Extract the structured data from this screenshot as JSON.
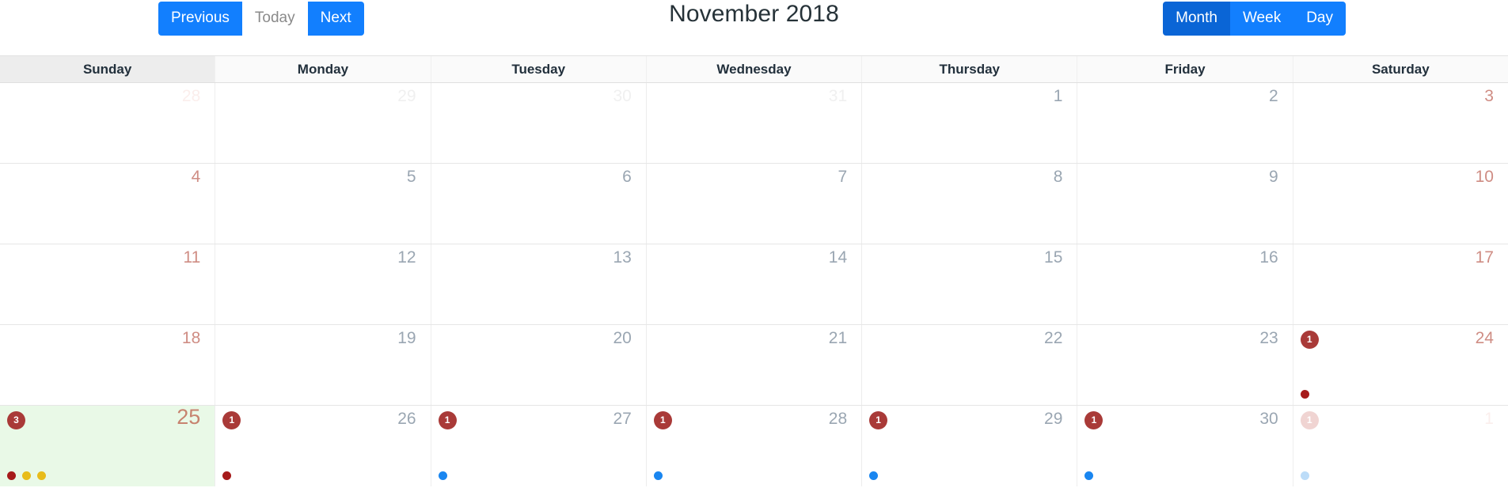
{
  "toolbar": {
    "nav_buttons": [
      {
        "label": "Previous",
        "name": "previous-button",
        "style": "primary"
      },
      {
        "label": "Today",
        "name": "today-button",
        "style": "light"
      },
      {
        "label": "Next",
        "name": "next-button",
        "style": "primary"
      }
    ],
    "title": "November 2018",
    "view_buttons": [
      {
        "label": "Month",
        "name": "month-view-button",
        "style": "active"
      },
      {
        "label": "Week",
        "name": "week-view-button",
        "style": "primary"
      },
      {
        "label": "Day",
        "name": "day-view-button",
        "style": "primary"
      }
    ]
  },
  "colors": {
    "primary_blue": "#127ffe",
    "active_blue": "#0a65d6",
    "badge_red": "#a93a38",
    "badge_red_faded": "#f0d4d2",
    "today_bg": "#e9f9e7",
    "dot_red": "#a61b1b",
    "dot_yellow": "#e8bc1a",
    "dot_blue": "#1a86f0",
    "dot_blue_faded": "#bcdcf8",
    "title_text": "#263238",
    "weekend_date": "#cf8d84",
    "weekday_date": "#9aa6b2"
  },
  "calendar": {
    "day_headers": [
      {
        "label": "Sunday",
        "weekend": true
      },
      {
        "label": "Monday",
        "weekend": false
      },
      {
        "label": "Tuesday",
        "weekend": false
      },
      {
        "label": "Wednesday",
        "weekend": false
      },
      {
        "label": "Thursday",
        "weekend": false
      },
      {
        "label": "Friday",
        "weekend": false
      },
      {
        "label": "Saturday",
        "weekend": false
      }
    ],
    "weeks": [
      [
        {
          "day": "28",
          "other_month": true,
          "weekend": true,
          "today": false,
          "badge": null,
          "dots": []
        },
        {
          "day": "29",
          "other_month": true,
          "weekend": false,
          "today": false,
          "badge": null,
          "dots": []
        },
        {
          "day": "30",
          "other_month": true,
          "weekend": false,
          "today": false,
          "badge": null,
          "dots": []
        },
        {
          "day": "31",
          "other_month": true,
          "weekend": false,
          "today": false,
          "badge": null,
          "dots": []
        },
        {
          "day": "1",
          "other_month": false,
          "weekend": false,
          "today": false,
          "badge": null,
          "dots": []
        },
        {
          "day": "2",
          "other_month": false,
          "weekend": false,
          "today": false,
          "badge": null,
          "dots": []
        },
        {
          "day": "3",
          "other_month": false,
          "weekend": true,
          "today": false,
          "badge": null,
          "dots": []
        }
      ],
      [
        {
          "day": "4",
          "other_month": false,
          "weekend": true,
          "today": false,
          "badge": null,
          "dots": []
        },
        {
          "day": "5",
          "other_month": false,
          "weekend": false,
          "today": false,
          "badge": null,
          "dots": []
        },
        {
          "day": "6",
          "other_month": false,
          "weekend": false,
          "today": false,
          "badge": null,
          "dots": []
        },
        {
          "day": "7",
          "other_month": false,
          "weekend": false,
          "today": false,
          "badge": null,
          "dots": []
        },
        {
          "day": "8",
          "other_month": false,
          "weekend": false,
          "today": false,
          "badge": null,
          "dots": []
        },
        {
          "day": "9",
          "other_month": false,
          "weekend": false,
          "today": false,
          "badge": null,
          "dots": []
        },
        {
          "day": "10",
          "other_month": false,
          "weekend": true,
          "today": false,
          "badge": null,
          "dots": []
        }
      ],
      [
        {
          "day": "11",
          "other_month": false,
          "weekend": true,
          "today": false,
          "badge": null,
          "dots": []
        },
        {
          "day": "12",
          "other_month": false,
          "weekend": false,
          "today": false,
          "badge": null,
          "dots": []
        },
        {
          "day": "13",
          "other_month": false,
          "weekend": false,
          "today": false,
          "badge": null,
          "dots": []
        },
        {
          "day": "14",
          "other_month": false,
          "weekend": false,
          "today": false,
          "badge": null,
          "dots": []
        },
        {
          "day": "15",
          "other_month": false,
          "weekend": false,
          "today": false,
          "badge": null,
          "dots": []
        },
        {
          "day": "16",
          "other_month": false,
          "weekend": false,
          "today": false,
          "badge": null,
          "dots": []
        },
        {
          "day": "17",
          "other_month": false,
          "weekend": true,
          "today": false,
          "badge": null,
          "dots": []
        }
      ],
      [
        {
          "day": "18",
          "other_month": false,
          "weekend": true,
          "today": false,
          "badge": null,
          "dots": []
        },
        {
          "day": "19",
          "other_month": false,
          "weekend": false,
          "today": false,
          "badge": null,
          "dots": []
        },
        {
          "day": "20",
          "other_month": false,
          "weekend": false,
          "today": false,
          "badge": null,
          "dots": []
        },
        {
          "day": "21",
          "other_month": false,
          "weekend": false,
          "today": false,
          "badge": null,
          "dots": []
        },
        {
          "day": "22",
          "other_month": false,
          "weekend": false,
          "today": false,
          "badge": null,
          "dots": []
        },
        {
          "day": "23",
          "other_month": false,
          "weekend": false,
          "today": false,
          "badge": null,
          "dots": []
        },
        {
          "day": "24",
          "other_month": false,
          "weekend": true,
          "today": false,
          "badge": "1",
          "badge_faded": false,
          "dots": [
            "dot_red"
          ]
        }
      ],
      [
        {
          "day": "25",
          "other_month": false,
          "weekend": true,
          "today": true,
          "badge": "3",
          "badge_faded": false,
          "dots": [
            "dot_red",
            "dot_yellow",
            "dot_yellow"
          ]
        },
        {
          "day": "26",
          "other_month": false,
          "weekend": false,
          "today": false,
          "badge": "1",
          "badge_faded": false,
          "dots": [
            "dot_red"
          ]
        },
        {
          "day": "27",
          "other_month": false,
          "weekend": false,
          "today": false,
          "badge": "1",
          "badge_faded": false,
          "dots": [
            "dot_blue"
          ]
        },
        {
          "day": "28",
          "other_month": false,
          "weekend": false,
          "today": false,
          "badge": "1",
          "badge_faded": false,
          "dots": [
            "dot_blue"
          ]
        },
        {
          "day": "29",
          "other_month": false,
          "weekend": false,
          "today": false,
          "badge": "1",
          "badge_faded": false,
          "dots": [
            "dot_blue"
          ]
        },
        {
          "day": "30",
          "other_month": false,
          "weekend": false,
          "today": false,
          "badge": "1",
          "badge_faded": false,
          "dots": [
            "dot_blue"
          ]
        },
        {
          "day": "1",
          "other_month": true,
          "weekend": true,
          "today": false,
          "badge": "1",
          "badge_faded": true,
          "dots": [
            "dot_blue_faded"
          ]
        }
      ]
    ]
  }
}
